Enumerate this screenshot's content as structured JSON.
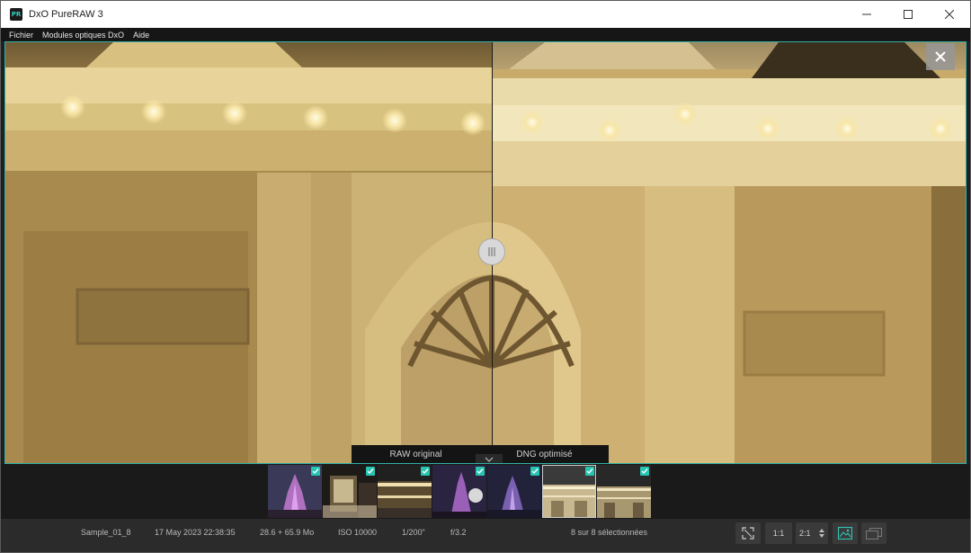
{
  "window": {
    "app_icon_text": "PR",
    "title": "DxO PureRAW 3"
  },
  "menu": {
    "items": [
      "Fichier",
      "Modules optiques DxO",
      "Aide"
    ]
  },
  "viewer": {
    "left_label": "RAW original",
    "right_label": "DNG optimisé"
  },
  "filmstrip": {
    "thumbnails": [
      {
        "name": "castle-purple",
        "checked": true,
        "selected": false
      },
      {
        "name": "sign-night",
        "checked": true,
        "selected": false
      },
      {
        "name": "building-lights",
        "checked": true,
        "selected": false
      },
      {
        "name": "castle-purple-2",
        "checked": true,
        "selected": false
      },
      {
        "name": "castle-blue",
        "checked": true,
        "selected": false
      },
      {
        "name": "facade-lights-selected",
        "checked": true,
        "selected": true
      },
      {
        "name": "facade-lights",
        "checked": true,
        "selected": false
      }
    ]
  },
  "status": {
    "filename": "Sample_01_8",
    "datetime": "17 May 2023 22:38:35",
    "size": "28.6 + 65.9 Mo",
    "iso": "ISO 10000",
    "shutter": "1/200\"",
    "aperture": "f/3.2",
    "selection": "8 sur 8 sélectionnées",
    "zoom_1_1": "1:1",
    "zoom_2_1": "2:1"
  },
  "colors": {
    "accent": "#2fb3a8",
    "check": "#27c4b2",
    "statusbar": "#2b2b2b"
  }
}
